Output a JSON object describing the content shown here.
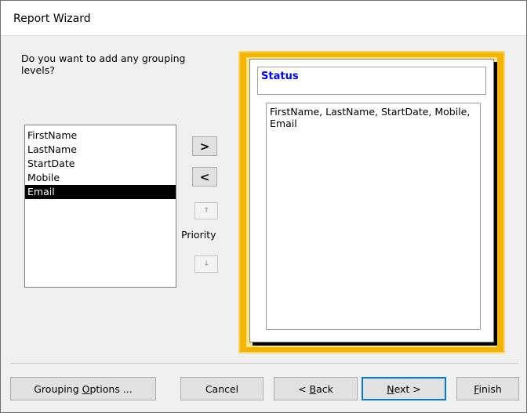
{
  "window": {
    "title": "Report Wizard"
  },
  "question": "Do you want to add any grouping levels?",
  "fields": [
    "FirstName",
    "LastName",
    "StartDate",
    "Mobile",
    "Email"
  ],
  "selected_field": "Email",
  "move_buttons": {
    "add": ">",
    "remove": "<",
    "priority_up": "↑",
    "priority_down": "↓",
    "priority_label": "Priority"
  },
  "preview": {
    "group_header": "Status",
    "detail_fields": "FirstName, LastName, StartDate, Mobile, Email"
  },
  "footer": {
    "grouping_options_pre": "Grouping ",
    "grouping_options_key": "O",
    "grouping_options_post": "ptions ...",
    "cancel": "Cancel",
    "back_pre": "< ",
    "back_key": "B",
    "back_post": "ack",
    "next_key": "N",
    "next_post": "ext >",
    "finish_key": "F",
    "finish_post": "inish"
  }
}
